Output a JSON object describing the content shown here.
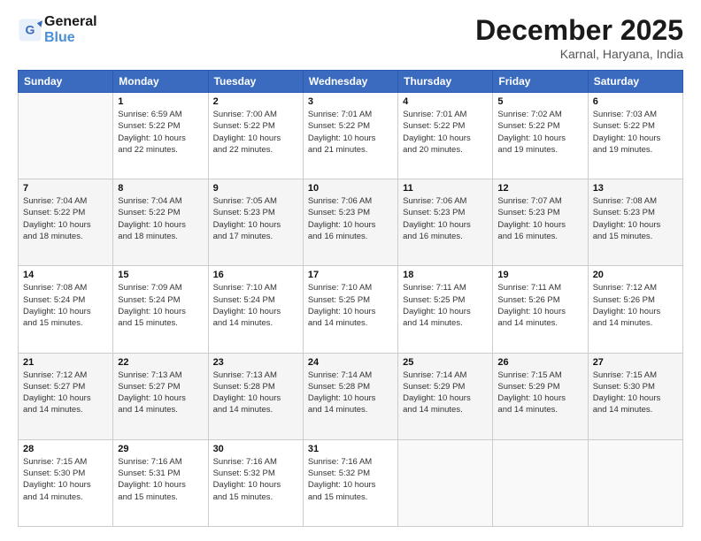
{
  "header": {
    "logo_line1": "General",
    "logo_line2": "Blue",
    "month_title": "December 2025",
    "location": "Karnal, Haryana, India"
  },
  "weekdays": [
    "Sunday",
    "Monday",
    "Tuesday",
    "Wednesday",
    "Thursday",
    "Friday",
    "Saturday"
  ],
  "weeks": [
    [
      {
        "day": "",
        "info": ""
      },
      {
        "day": "1",
        "info": "Sunrise: 6:59 AM\nSunset: 5:22 PM\nDaylight: 10 hours\nand 22 minutes."
      },
      {
        "day": "2",
        "info": "Sunrise: 7:00 AM\nSunset: 5:22 PM\nDaylight: 10 hours\nand 22 minutes."
      },
      {
        "day": "3",
        "info": "Sunrise: 7:01 AM\nSunset: 5:22 PM\nDaylight: 10 hours\nand 21 minutes."
      },
      {
        "day": "4",
        "info": "Sunrise: 7:01 AM\nSunset: 5:22 PM\nDaylight: 10 hours\nand 20 minutes."
      },
      {
        "day": "5",
        "info": "Sunrise: 7:02 AM\nSunset: 5:22 PM\nDaylight: 10 hours\nand 19 minutes."
      },
      {
        "day": "6",
        "info": "Sunrise: 7:03 AM\nSunset: 5:22 PM\nDaylight: 10 hours\nand 19 minutes."
      }
    ],
    [
      {
        "day": "7",
        "info": "Sunrise: 7:04 AM\nSunset: 5:22 PM\nDaylight: 10 hours\nand 18 minutes."
      },
      {
        "day": "8",
        "info": "Sunrise: 7:04 AM\nSunset: 5:22 PM\nDaylight: 10 hours\nand 18 minutes."
      },
      {
        "day": "9",
        "info": "Sunrise: 7:05 AM\nSunset: 5:23 PM\nDaylight: 10 hours\nand 17 minutes."
      },
      {
        "day": "10",
        "info": "Sunrise: 7:06 AM\nSunset: 5:23 PM\nDaylight: 10 hours\nand 16 minutes."
      },
      {
        "day": "11",
        "info": "Sunrise: 7:06 AM\nSunset: 5:23 PM\nDaylight: 10 hours\nand 16 minutes."
      },
      {
        "day": "12",
        "info": "Sunrise: 7:07 AM\nSunset: 5:23 PM\nDaylight: 10 hours\nand 16 minutes."
      },
      {
        "day": "13",
        "info": "Sunrise: 7:08 AM\nSunset: 5:23 PM\nDaylight: 10 hours\nand 15 minutes."
      }
    ],
    [
      {
        "day": "14",
        "info": "Sunrise: 7:08 AM\nSunset: 5:24 PM\nDaylight: 10 hours\nand 15 minutes."
      },
      {
        "day": "15",
        "info": "Sunrise: 7:09 AM\nSunset: 5:24 PM\nDaylight: 10 hours\nand 15 minutes."
      },
      {
        "day": "16",
        "info": "Sunrise: 7:10 AM\nSunset: 5:24 PM\nDaylight: 10 hours\nand 14 minutes."
      },
      {
        "day": "17",
        "info": "Sunrise: 7:10 AM\nSunset: 5:25 PM\nDaylight: 10 hours\nand 14 minutes."
      },
      {
        "day": "18",
        "info": "Sunrise: 7:11 AM\nSunset: 5:25 PM\nDaylight: 10 hours\nand 14 minutes."
      },
      {
        "day": "19",
        "info": "Sunrise: 7:11 AM\nSunset: 5:26 PM\nDaylight: 10 hours\nand 14 minutes."
      },
      {
        "day": "20",
        "info": "Sunrise: 7:12 AM\nSunset: 5:26 PM\nDaylight: 10 hours\nand 14 minutes."
      }
    ],
    [
      {
        "day": "21",
        "info": "Sunrise: 7:12 AM\nSunset: 5:27 PM\nDaylight: 10 hours\nand 14 minutes."
      },
      {
        "day": "22",
        "info": "Sunrise: 7:13 AM\nSunset: 5:27 PM\nDaylight: 10 hours\nand 14 minutes."
      },
      {
        "day": "23",
        "info": "Sunrise: 7:13 AM\nSunset: 5:28 PM\nDaylight: 10 hours\nand 14 minutes."
      },
      {
        "day": "24",
        "info": "Sunrise: 7:14 AM\nSunset: 5:28 PM\nDaylight: 10 hours\nand 14 minutes."
      },
      {
        "day": "25",
        "info": "Sunrise: 7:14 AM\nSunset: 5:29 PM\nDaylight: 10 hours\nand 14 minutes."
      },
      {
        "day": "26",
        "info": "Sunrise: 7:15 AM\nSunset: 5:29 PM\nDaylight: 10 hours\nand 14 minutes."
      },
      {
        "day": "27",
        "info": "Sunrise: 7:15 AM\nSunset: 5:30 PM\nDaylight: 10 hours\nand 14 minutes."
      }
    ],
    [
      {
        "day": "28",
        "info": "Sunrise: 7:15 AM\nSunset: 5:30 PM\nDaylight: 10 hours\nand 14 minutes."
      },
      {
        "day": "29",
        "info": "Sunrise: 7:16 AM\nSunset: 5:31 PM\nDaylight: 10 hours\nand 15 minutes."
      },
      {
        "day": "30",
        "info": "Sunrise: 7:16 AM\nSunset: 5:32 PM\nDaylight: 10 hours\nand 15 minutes."
      },
      {
        "day": "31",
        "info": "Sunrise: 7:16 AM\nSunset: 5:32 PM\nDaylight: 10 hours\nand 15 minutes."
      },
      {
        "day": "",
        "info": ""
      },
      {
        "day": "",
        "info": ""
      },
      {
        "day": "",
        "info": ""
      }
    ]
  ]
}
